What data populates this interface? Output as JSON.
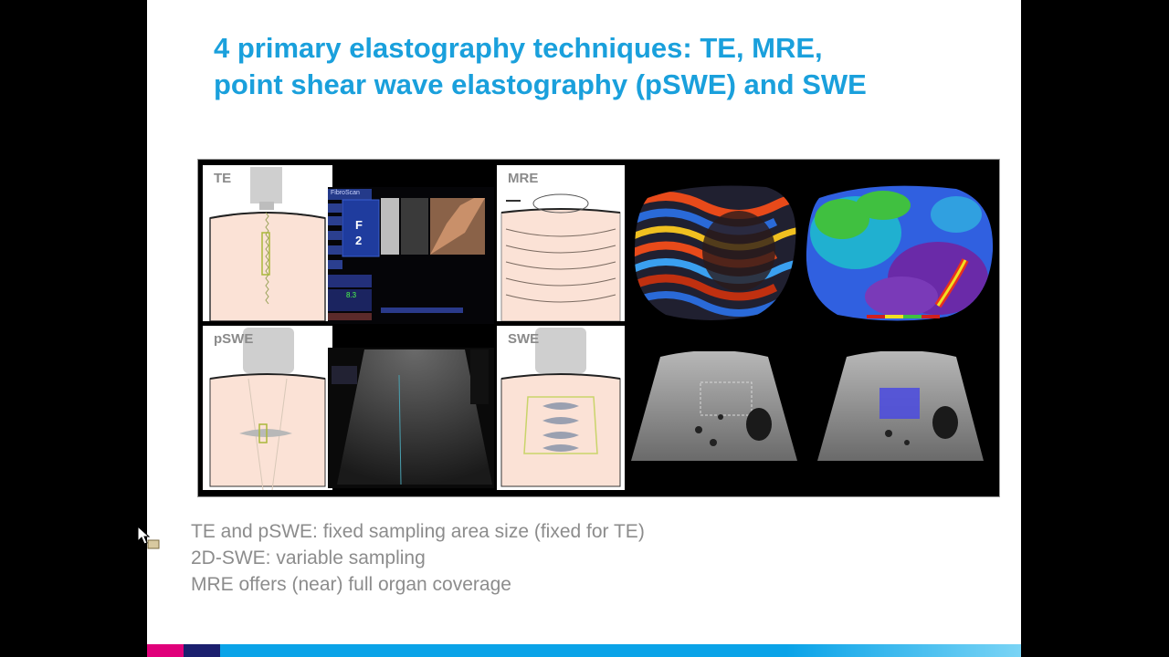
{
  "slide": {
    "title_line1": "4 primary elastography techniques: TE, MRE,",
    "title_line2": "point shear wave elastography (pSWE) and SWE",
    "bullets": [
      "TE and pSWE: fixed sampling area size (fixed for TE)",
      "2D-SWE: variable sampling",
      "MRE offers (near) full organ coverage"
    ]
  },
  "figure": {
    "panels": {
      "te": "TE",
      "pswe": "pSWE",
      "mre": "MRE",
      "swe": "SWE"
    },
    "fibroscan": {
      "brand": "FibroScan",
      "value_line1": "F",
      "value_line2": "2",
      "reading": "8.3"
    }
  },
  "colors": {
    "title": "#1aa0dc",
    "bullets": "#8c8c8c",
    "tissue": "#fbe2d6",
    "transducer": "#c8c8c8",
    "roi": "#c9d46a"
  }
}
